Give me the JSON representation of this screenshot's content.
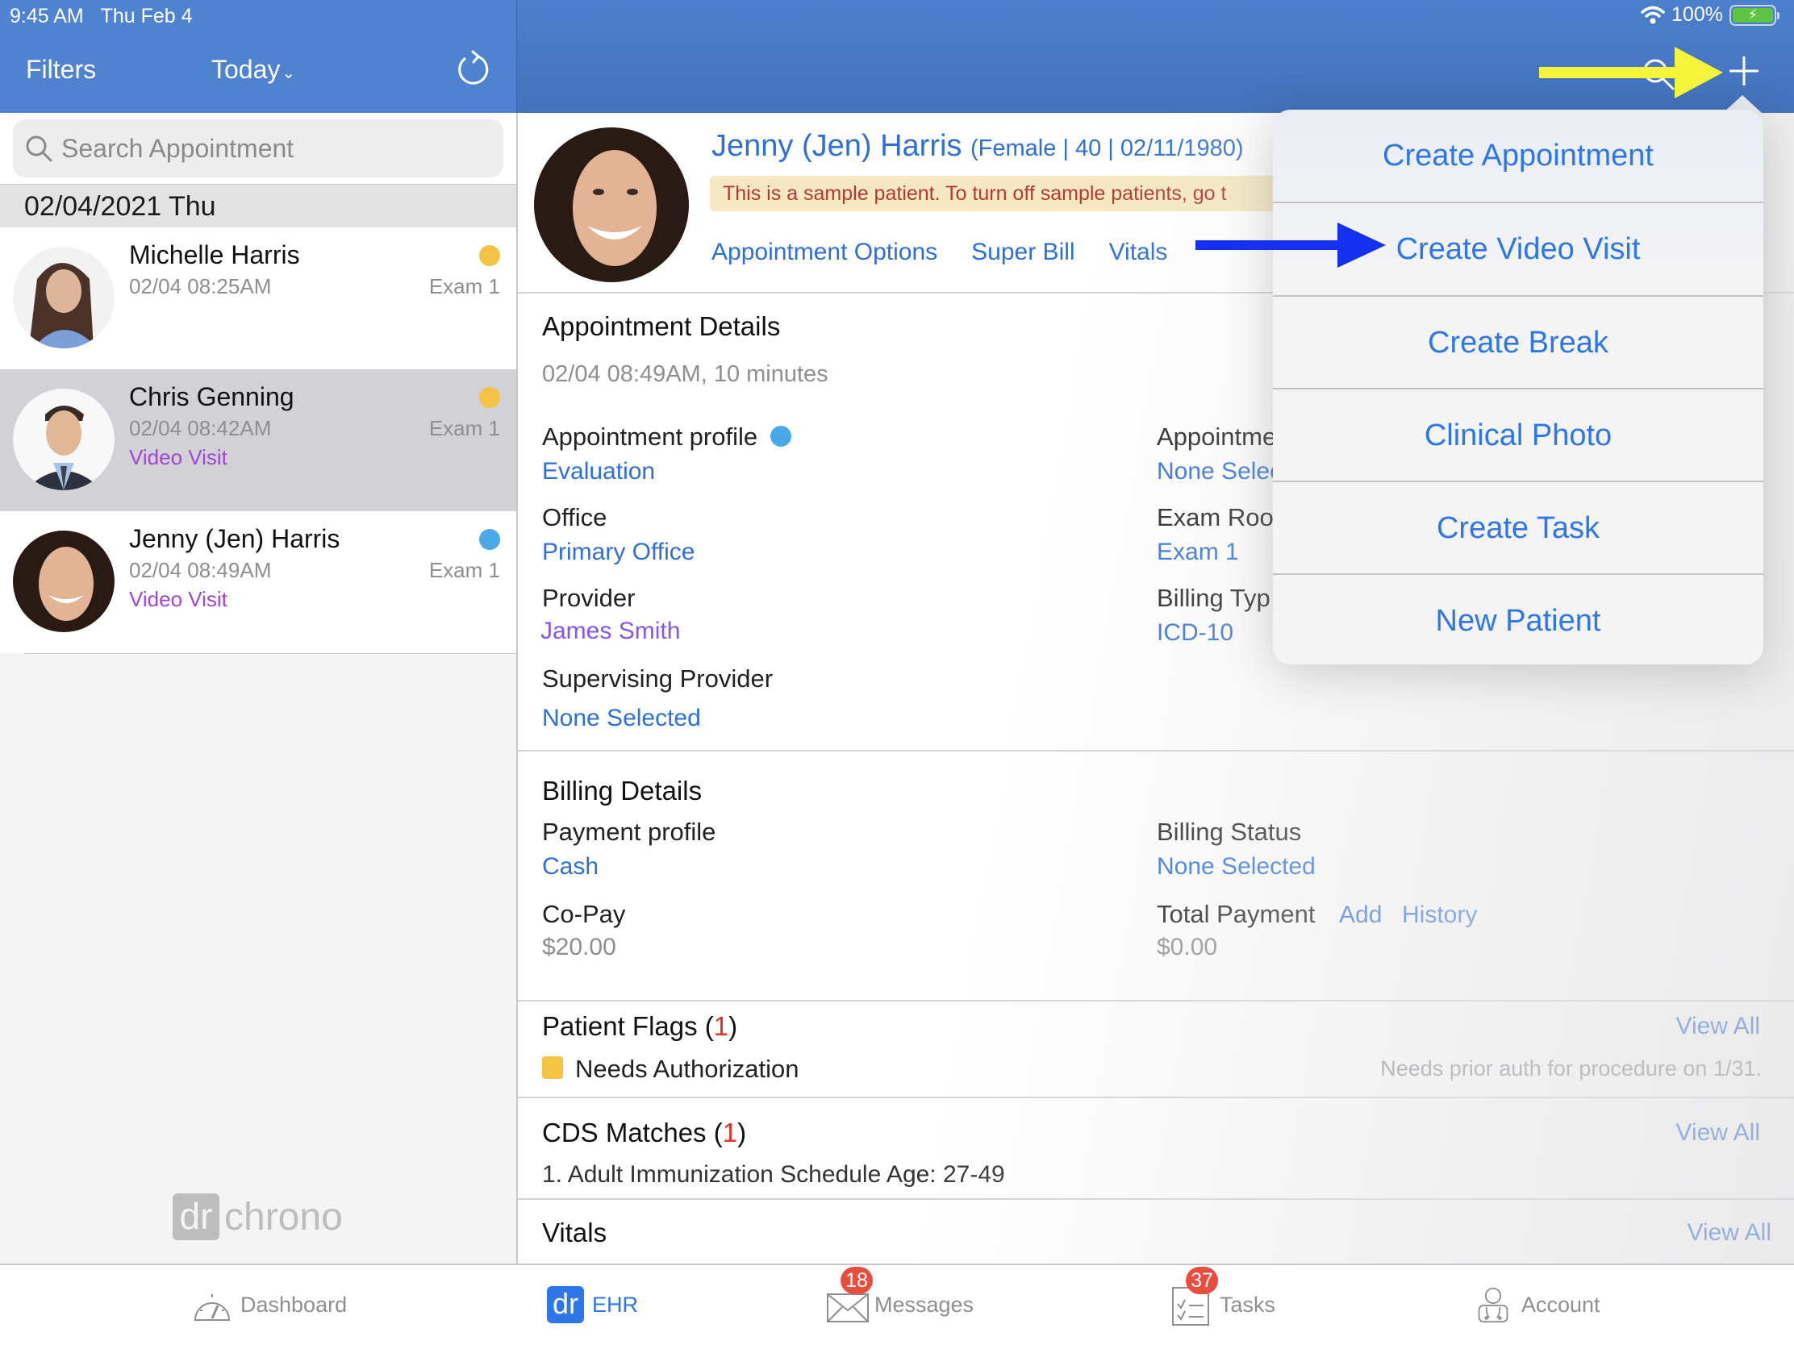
{
  "status_bar": {
    "time": "9:45 AM",
    "date": "Thu Feb 4",
    "battery": "100%"
  },
  "left_header": {
    "filters_label": "Filters",
    "date_filter": "Today",
    "refresh_icon": "refresh-icon"
  },
  "right_header": {
    "search_icon": "search-icon",
    "add_icon": "plus-icon"
  },
  "search": {
    "placeholder": "Search Appointment",
    "value": ""
  },
  "schedule": {
    "date_header": "02/04/2021 Thu",
    "appointments": [
      {
        "name": "Michelle Harris",
        "time": "02/04 08:25AM",
        "room": "Exam 1",
        "visit_type": "",
        "status_color": "#f5c344",
        "selected": false
      },
      {
        "name": "Chris Genning",
        "time": "02/04 08:42AM",
        "room": "Exam 1",
        "visit_type": "Video Visit",
        "status_color": "#f5c344",
        "selected": true
      },
      {
        "name": "Jenny (Jen) Harris",
        "time": "02/04 08:49AM",
        "room": "Exam 1",
        "visit_type": "Video Visit",
        "status_color": "#4aa8e8",
        "selected": false
      }
    ]
  },
  "brand": {
    "mark": "dr",
    "name": "chrono"
  },
  "patient": {
    "name": "Jenny (Jen) Harris",
    "meta": "(Female | 40 | 02/11/1980)",
    "banner": "This is a sample patient. To turn off sample patients, go t",
    "links": [
      "Appointment Options",
      "Super Bill",
      "Vitals"
    ]
  },
  "appointment_details": {
    "title": "Appointment Details",
    "datetime": "02/04 08:49AM, 10 minutes",
    "fields": {
      "profile_label": "Appointment profile",
      "profile_value": "Evaluation",
      "office_label": "Office",
      "office_value": "Primary Office",
      "provider_label": "Provider",
      "provider_value": "James Smith",
      "supervising_label": "Supervising Provider",
      "supervising_value": "None Selected",
      "appt_status_label": "Appointme",
      "appt_status_value": "None Selec",
      "exam_room_label": "Exam Roo",
      "exam_room_value": "Exam 1",
      "billing_type_label": "Billing Typ",
      "billing_type_value": "ICD-10"
    }
  },
  "billing_details": {
    "title": "Billing Details",
    "payment_profile_label": "Payment profile",
    "payment_profile_value": "Cash",
    "billing_status_label": "Billing Status",
    "billing_status_value": "None Selected",
    "copay_label": "Co-Pay",
    "copay_value": "$20.00",
    "total_payment_label": "Total Payment",
    "total_payment_value": "$0.00",
    "add_link": "Add",
    "history_link": "History"
  },
  "patient_flags": {
    "title": "Patient Flags",
    "count": "1",
    "view_all": "View All",
    "flag_name": "Needs Authorization",
    "flag_note": "Needs prior auth for procedure on 1/31.",
    "flag_color": "#f5c344"
  },
  "cds_matches": {
    "title": "CDS Matches",
    "count": "1",
    "view_all": "View All",
    "item": "1. Adult Immunization Schedule Age: 27-49"
  },
  "vitals": {
    "title": "Vitals",
    "view_all": "View All"
  },
  "popover_menu": {
    "items": [
      "Create Appointment",
      "Create Video Visit",
      "Create Break",
      "Clinical Photo",
      "Create Task",
      "New Patient"
    ]
  },
  "tabbar": {
    "tabs": [
      {
        "label": "Dashboard",
        "icon": "speedometer-icon",
        "badge": ""
      },
      {
        "label": "EHR",
        "icon": "drchrono-icon",
        "badge": "",
        "active": true
      },
      {
        "label": "Messages",
        "icon": "envelope-icon",
        "badge": "18"
      },
      {
        "label": "Tasks",
        "icon": "checklist-icon",
        "badge": "37"
      },
      {
        "label": "Account",
        "icon": "doctor-icon",
        "badge": ""
      }
    ]
  },
  "colors": {
    "header_blue": "#4f82cf",
    "link_blue": "#2f6fd6",
    "purple": "#8a56e8",
    "badge_red": "#e84d3d",
    "annotation_yellow": "#f4f43a",
    "annotation_blue": "#1530f0"
  }
}
